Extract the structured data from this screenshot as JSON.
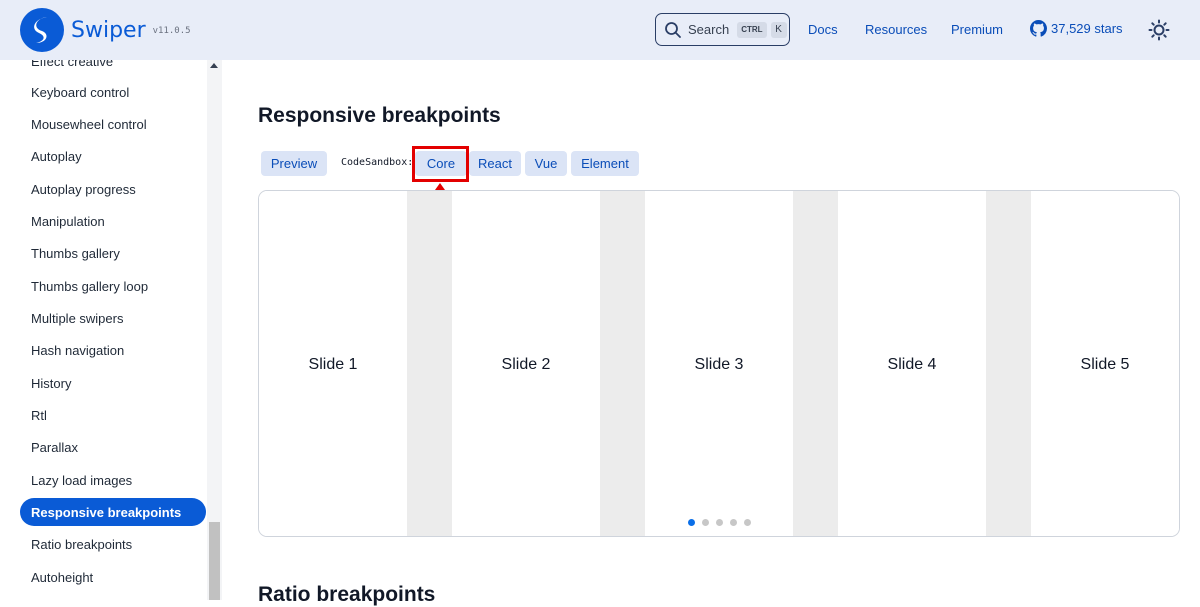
{
  "header": {
    "brand": "Swiper",
    "version": "v11.0.5",
    "search_label": "Search",
    "search_kbd_1": "CTRL",
    "search_kbd_2": "K",
    "nav": {
      "docs": "Docs",
      "resources": "Resources",
      "premium": "Premium",
      "github": "37,529 stars"
    },
    "colors": {
      "brand": "#0a5bd6",
      "header_bg": "#e8edf8"
    }
  },
  "sidebar": {
    "items": [
      {
        "label": "Effect creative"
      },
      {
        "label": "Keyboard control"
      },
      {
        "label": "Mousewheel control"
      },
      {
        "label": "Autoplay"
      },
      {
        "label": "Autoplay progress"
      },
      {
        "label": "Manipulation"
      },
      {
        "label": "Thumbs gallery"
      },
      {
        "label": "Thumbs gallery loop"
      },
      {
        "label": "Multiple swipers"
      },
      {
        "label": "Hash navigation"
      },
      {
        "label": "History"
      },
      {
        "label": "Rtl"
      },
      {
        "label": "Parallax"
      },
      {
        "label": "Lazy load images"
      },
      {
        "label": "Responsive breakpoints",
        "active": true
      },
      {
        "label": "Ratio breakpoints"
      },
      {
        "label": "Autoheight"
      }
    ]
  },
  "main": {
    "title": "Responsive breakpoints",
    "tabs": {
      "preview": "Preview",
      "codesandbox_label": "CodeSandbox:",
      "core": "Core",
      "react": "React",
      "vue": "Vue",
      "element": "Element"
    },
    "slides": [
      "Slide 1",
      "Slide 2",
      "Slide 3",
      "Slide 4",
      "Slide 5"
    ],
    "pagination_active_index": 0,
    "pagination_count": 5,
    "next_title": "Ratio breakpoints"
  },
  "annotation": {
    "highlight_color": "#e30000",
    "target": "Core"
  }
}
